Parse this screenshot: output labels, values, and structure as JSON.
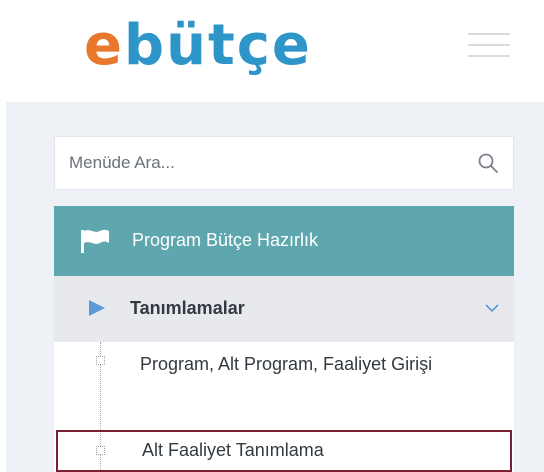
{
  "header": {
    "logo": {
      "part_a": "e",
      "part_b": "bütçe"
    },
    "menu_icon": "hamburger-icon"
  },
  "sidebar": {
    "search": {
      "placeholder": "Menüde Ara...",
      "value": "",
      "icon": "search-icon"
    },
    "menu_header": {
      "label": "Program Bütçe Hazırlık",
      "icon": "flag-icon",
      "color": "#5fa7ae"
    },
    "submenu": {
      "label": "Tanımlamalar",
      "icon": "triangle-right-icon",
      "expanded": true,
      "chevron": "chevron-down-icon"
    },
    "items": [
      {
        "label": "Program, Alt Program, Faaliyet Girişi",
        "selected": false
      },
      {
        "label": "Alt Faaliyet Tanımlama",
        "selected": true
      }
    ]
  },
  "colors": {
    "logo_orange": "#e9772c",
    "logo_blue": "#2e95c9",
    "menu_teal": "#5fa7ae",
    "selected_border": "#7a2233"
  }
}
